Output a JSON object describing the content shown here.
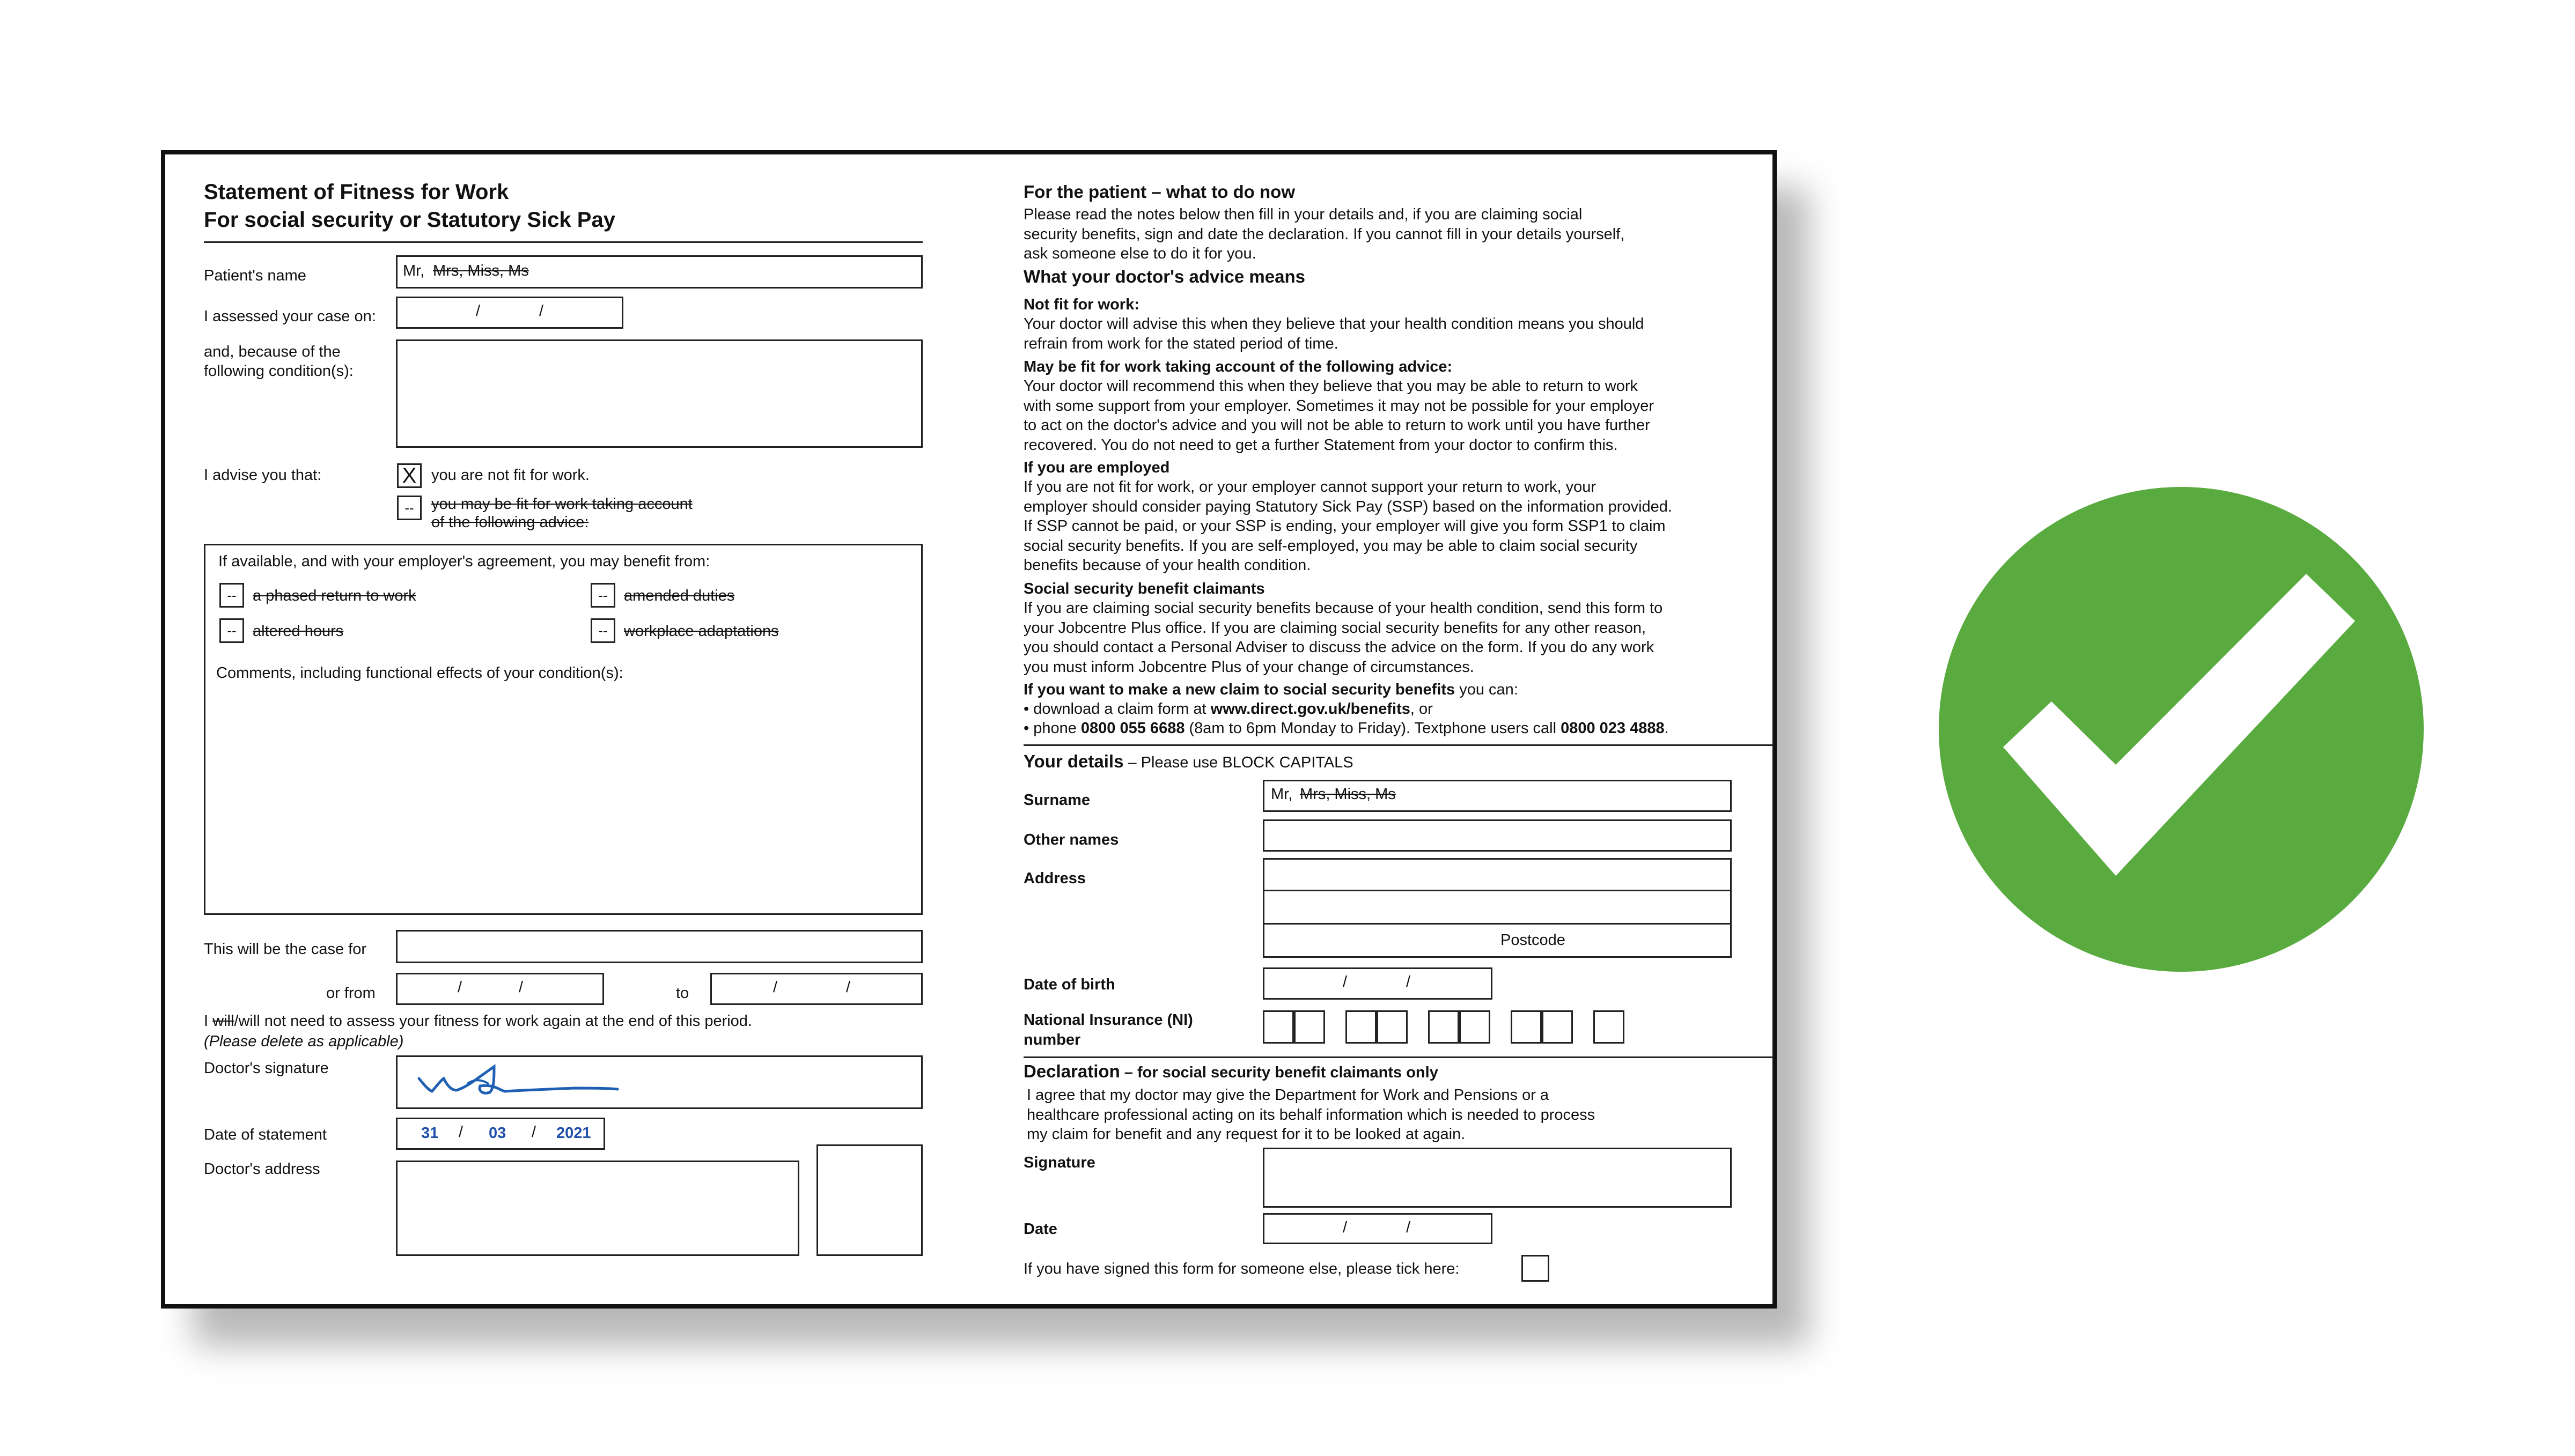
{
  "form": {
    "title": "Statement of Fitness for Work",
    "subtitle": "For social security or Statutory Sick Pay",
    "patient_name_label": "Patient's name",
    "patient_name_value_plain": "Mr,",
    "patient_name_value_struck": "Mrs, Miss, Ms",
    "assessed_label": "I assessed your case on:",
    "condition_label": "and, because of the following condition(s):",
    "advise_label": "I advise you that:",
    "option_not_fit": "you are not fit for work.",
    "option_not_fit_mark": "X",
    "option_may_be_fit_line1": "you may be fit for work taking account",
    "option_may_be_fit_line2": "of the following advice:",
    "dash_mark": "--",
    "benefit_intro": "If available, and with your employer's agreement, you may benefit from:",
    "benefit_phased": "a phased return to work",
    "benefit_amended": "amended duties",
    "benefit_altered": "altered hours",
    "benefit_adaptations": "workplace adaptations",
    "comments_label": "Comments, including functional effects of your condition(s):",
    "case_for_label": "This will be the case for",
    "or_from_label": "or from",
    "to_label": "to",
    "assess_again_struck": "will",
    "assess_again_prefix": "I ",
    "assess_again_rest": "/will not need to assess your fitness for work again at the end of this period.",
    "delete_note": "(Please delete as applicable)",
    "signature_label": "Doctor's signature",
    "date_statement_label": "Date of statement",
    "date_day": "31",
    "date_month": "03",
    "date_year": "2021",
    "doctor_address_label": "Doctor's address",
    "slash": "/"
  },
  "patient": {
    "heading": "For the patient",
    "heading_suffix": " – what to do now",
    "intro": "Please read the notes below then fill in your details and, if you are claiming social\nsecurity benefits, sign and date the declaration. If you cannot fill in your details yourself,\nask someone else to do it for you.",
    "advice_heading": "What your doctor's advice means",
    "not_fit_heading": "Not fit for work:",
    "not_fit_text": "Your doctor will advise this when they believe that your health condition means you should\nrefrain from work for the stated period of time.",
    "may_be_fit_heading": "May be fit for work taking account of the following advice:",
    "may_be_fit_text": "Your doctor will recommend this when they believe that you may be able to return to work\nwith some support from your employer. Sometimes it may not be possible for your employer\nto act on the doctor's advice and you will not be able to return to work until you have further\nrecovered. You do not need to get a further Statement from your doctor to confirm this.",
    "employed_heading": "If you are employed",
    "employed_text": "If you are not fit for work, or your employer cannot support your return to work, your\nemployer should consider paying Statutory Sick Pay (SSP) based on the information provided.\nIf SSP cannot be paid, or your SSP is ending, your employer will give you form SSP1 to claim\nsocial security benefits. If you are self-employed, you may be able to claim social security\nbenefits because of your health condition.",
    "claimants_heading": "Social security benefit claimants",
    "claimants_text": "If you are claiming social security benefits because of your health condition, send this form to\nyour Jobcentre Plus office. If you are claiming social security benefits for any other reason,\nyou should contact a Personal Adviser to discuss the advice on the form. If you do any work\nyou must inform Jobcentre Plus of your change of circumstances.",
    "new_claim_heading": "If you want to make a new claim to social security benefits",
    "new_claim_suffix": " you can:",
    "bullet1_prefix": "•  download a claim form at ",
    "bullet1_link": "www.direct.gov.uk/benefits",
    "bullet1_suffix": ", or",
    "bullet2_prefix": "•  phone ",
    "bullet2_phone": "0800 055 6688",
    "bullet2_mid": " (8am to 6pm Monday to Friday). Textphone users call ",
    "bullet2_text_phone": "0800 023 4888",
    "bullet2_end": "."
  },
  "details": {
    "heading": "Your details",
    "heading_note": " – Please use BLOCK CAPITALS",
    "surname_label": "Surname",
    "surname_value_plain": "Mr,",
    "surname_value_struck": "Mrs, Miss, Ms",
    "other_names_label": "Other names",
    "address_label": "Address",
    "postcode_label": "Postcode",
    "dob_label": "Date of birth",
    "ni_label": "National Insurance (NI)\nnumber"
  },
  "declaration": {
    "heading": "Declaration",
    "heading_note": " – for social security benefit claimants only",
    "text": "I agree that my doctor may give the Department for Work and Pensions or a\nhealthcare professional acting on its behalf information which is needed to process\nmy claim for benefit and any request for it to be looked at again.",
    "signature_label": "Signature",
    "date_label": "Date",
    "someone_else_label": "If you have signed this form for someone else, please tick here:"
  },
  "verdict": {
    "icon": "check-circle-icon",
    "color": "#5aab3f"
  }
}
